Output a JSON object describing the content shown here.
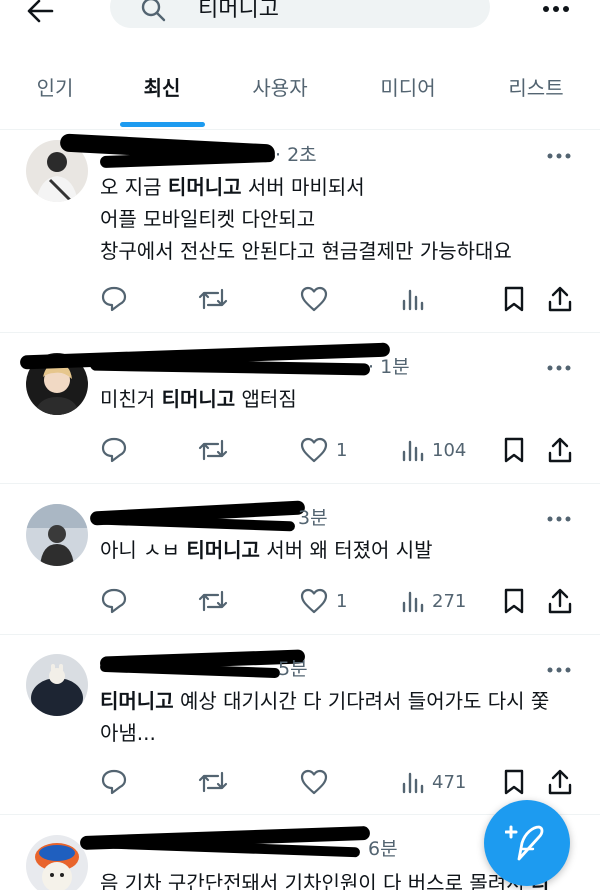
{
  "search": {
    "query": "티머니고"
  },
  "tabs": [
    {
      "label": "인기",
      "active": false
    },
    {
      "label": "최신",
      "active": true
    },
    {
      "label": "사용자",
      "active": false
    },
    {
      "label": "미디어",
      "active": false
    },
    {
      "label": "리스트",
      "active": false
    }
  ],
  "tweets": [
    {
      "time": "· 2초",
      "lines": [
        {
          "pre": "오 지금 ",
          "bold": "티머니고",
          "post": " 서버 마비되서"
        },
        {
          "pre": "어플 모바일티켓 다안되고",
          "bold": "",
          "post": ""
        },
        {
          "pre": "창구에서 전산도 안된다고 현금결제만 가능하대요",
          "bold": "",
          "post": ""
        }
      ],
      "likes": "",
      "views": ""
    },
    {
      "time": "· 1분",
      "lines": [
        {
          "pre": "미친거 ",
          "bold": "티머니고",
          "post": " 앱터짐"
        }
      ],
      "likes": "1",
      "views": "104"
    },
    {
      "time": "3분",
      "lines": [
        {
          "pre": "아니 ㅅㅂ ",
          "bold": "티머니고",
          "post": " 서버 왜 터졌어 시발"
        }
      ],
      "likes": "1",
      "views": "271"
    },
    {
      "time": "5분",
      "lines": [
        {
          "pre": "",
          "bold": "티머니고",
          "post": " 예상 대기시간 다 기다려서 들어가도 다시 쫓"
        },
        {
          "pre": "아냄...",
          "bold": "",
          "post": ""
        }
      ],
      "likes": "",
      "views": "471"
    },
    {
      "time": "6분",
      "lines": [
        {
          "pre": "음 기차 구간단전돼서 기차인원이 다 버스로 몰려서 ",
          "bold": "티",
          "post": ""
        }
      ],
      "likes": "",
      "views": ""
    }
  ],
  "colors": {
    "accent": "#1d9bf0",
    "muted": "#536471",
    "text": "#0f1419",
    "searchBg": "#eff3f4"
  },
  "icons": {
    "back": "arrow-left-icon",
    "search": "search-icon",
    "more": "more-horizontal-icon",
    "reply": "reply-icon",
    "retweet": "retweet-icon",
    "like": "heart-icon",
    "views": "views-icon",
    "bookmark": "bookmark-icon",
    "share": "share-icon",
    "compose": "compose-feather-icon"
  }
}
